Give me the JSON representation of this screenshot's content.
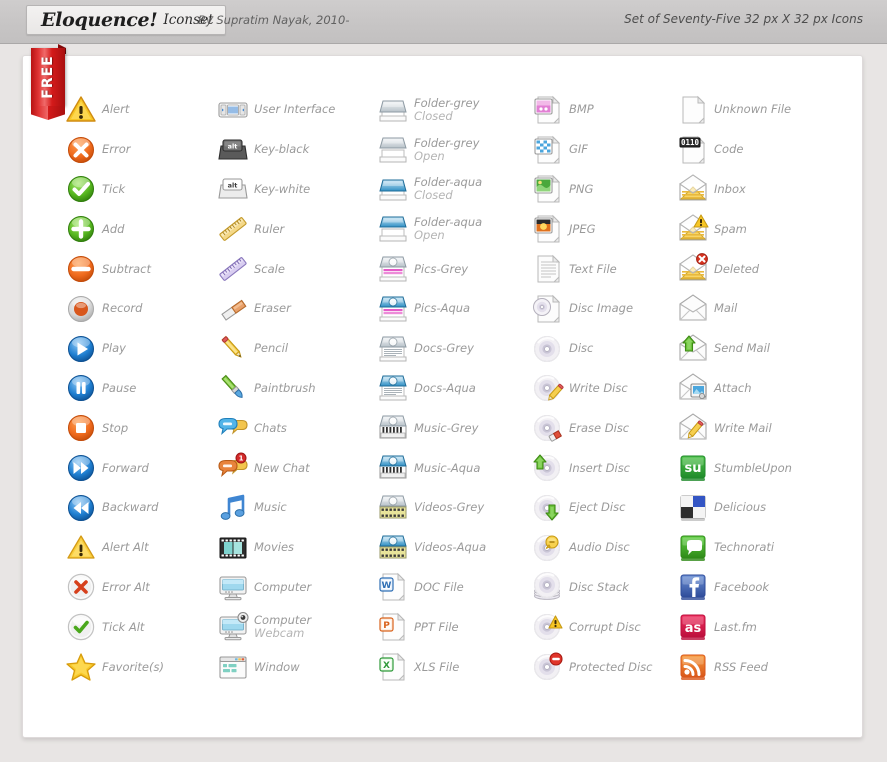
{
  "header": {
    "title_main": "Eloquence!",
    "title_sub": "Iconset",
    "byline": "By Supratim Nayak, 2010-",
    "right_text": "Set of Seventy-Five 32 px X 32 px Icons",
    "ribbon_label": "FREE"
  },
  "colors": {
    "page_bg": "#e8e5e4",
    "header_bg": "#c7c5c5",
    "card_bg": "#ffffff",
    "label_text": "#9a9a9a",
    "ribbon": "#d41a1a"
  },
  "columns": [
    {
      "name": "column-1",
      "items": [
        {
          "label": "Alert",
          "icon": "alert-icon"
        },
        {
          "label": "Error",
          "icon": "error-icon"
        },
        {
          "label": "Tick",
          "icon": "tick-icon"
        },
        {
          "label": "Add",
          "icon": "add-icon"
        },
        {
          "label": "Subtract",
          "icon": "subtract-icon"
        },
        {
          "label": "Record",
          "icon": "record-icon"
        },
        {
          "label": "Play",
          "icon": "play-icon"
        },
        {
          "label": "Pause",
          "icon": "pause-icon"
        },
        {
          "label": "Stop",
          "icon": "stop-icon"
        },
        {
          "label": "Forward",
          "icon": "forward-icon"
        },
        {
          "label": "Backward",
          "icon": "backward-icon"
        },
        {
          "label": "Alert Alt",
          "icon": "alert-alt-icon"
        },
        {
          "label": "Error Alt",
          "icon": "error-alt-icon"
        },
        {
          "label": "Tick Alt",
          "icon": "tick-alt-icon"
        },
        {
          "label": "Favorite(s)",
          "icon": "favorite-star-icon"
        }
      ]
    },
    {
      "name": "column-2",
      "items": [
        {
          "label": "User Interface",
          "icon": "user-interface-icon"
        },
        {
          "label": "Key-black",
          "icon": "key-black-icon"
        },
        {
          "label": "Key-white",
          "icon": "key-white-icon"
        },
        {
          "label": "Ruler",
          "icon": "ruler-icon"
        },
        {
          "label": "Scale",
          "icon": "scale-icon"
        },
        {
          "label": "Eraser",
          "icon": "eraser-icon"
        },
        {
          "label": "Pencil",
          "icon": "pencil-icon"
        },
        {
          "label": "Paintbrush",
          "icon": "paintbrush-icon"
        },
        {
          "label": "Chats",
          "icon": "chats-icon"
        },
        {
          "label": "New Chat",
          "icon": "new-chat-icon"
        },
        {
          "label": "Music",
          "icon": "music-note-icon"
        },
        {
          "label": "Movies",
          "icon": "movies-film-icon"
        },
        {
          "label": "Computer",
          "icon": "computer-icon"
        },
        {
          "label": "Computer",
          "label2": "Webcam",
          "icon": "computer-webcam-icon"
        },
        {
          "label": "Window",
          "icon": "window-icon"
        }
      ]
    },
    {
      "name": "column-3",
      "items": [
        {
          "label": "Folder-grey",
          "label2": "Closed",
          "icon": "folder-grey-closed-icon"
        },
        {
          "label": "Folder-grey",
          "label2": "Open",
          "icon": "folder-grey-open-icon"
        },
        {
          "label": "Folder-aqua",
          "label2": "Closed",
          "icon": "folder-aqua-closed-icon"
        },
        {
          "label": "Folder-aqua",
          "label2": "Open",
          "icon": "folder-aqua-open-icon"
        },
        {
          "label": "Pics-Grey",
          "icon": "pics-grey-icon"
        },
        {
          "label": "Pics-Aqua",
          "icon": "pics-aqua-icon"
        },
        {
          "label": "Docs-Grey",
          "icon": "docs-grey-icon"
        },
        {
          "label": "Docs-Aqua",
          "icon": "docs-aqua-icon"
        },
        {
          "label": "Music-Grey",
          "icon": "music-grey-icon"
        },
        {
          "label": "Music-Aqua",
          "icon": "music-aqua-icon"
        },
        {
          "label": "Videos-Grey",
          "icon": "videos-grey-icon"
        },
        {
          "label": "Videos-Aqua",
          "icon": "videos-aqua-icon"
        },
        {
          "label": "DOC File",
          "icon": "doc-file-icon"
        },
        {
          "label": "PPT File",
          "icon": "ppt-file-icon"
        },
        {
          "label": "XLS File",
          "icon": "xls-file-icon"
        }
      ]
    },
    {
      "name": "column-4",
      "items": [
        {
          "label": "BMP",
          "icon": "bmp-file-icon"
        },
        {
          "label": "GIF",
          "icon": "gif-file-icon"
        },
        {
          "label": "PNG",
          "icon": "png-file-icon"
        },
        {
          "label": "JPEG",
          "icon": "jpeg-file-icon"
        },
        {
          "label": "Text File",
          "icon": "text-file-icon"
        },
        {
          "label": "Disc Image",
          "icon": "disc-image-icon"
        },
        {
          "label": "Disc",
          "icon": "disc-icon"
        },
        {
          "label": "Write Disc",
          "icon": "write-disc-icon"
        },
        {
          "label": "Erase Disc",
          "icon": "erase-disc-icon"
        },
        {
          "label": "Insert Disc",
          "icon": "insert-disc-icon"
        },
        {
          "label": "Eject Disc",
          "icon": "eject-disc-icon"
        },
        {
          "label": "Audio Disc",
          "icon": "audio-disc-icon"
        },
        {
          "label": "Disc Stack",
          "icon": "disc-stack-icon"
        },
        {
          "label": "Corrupt Disc",
          "icon": "corrupt-disc-icon"
        },
        {
          "label": "Protected Disc",
          "icon": "protected-disc-icon"
        }
      ]
    },
    {
      "name": "column-5",
      "items": [
        {
          "label": "Unknown File",
          "icon": "unknown-file-icon"
        },
        {
          "label": "Code",
          "icon": "code-file-icon"
        },
        {
          "label": "Inbox",
          "icon": "inbox-icon"
        },
        {
          "label": "Spam",
          "icon": "spam-icon"
        },
        {
          "label": "Deleted",
          "icon": "deleted-mail-icon"
        },
        {
          "label": "Mail",
          "icon": "mail-icon"
        },
        {
          "label": "Send Mail",
          "icon": "send-mail-icon"
        },
        {
          "label": "Attach",
          "icon": "attach-icon"
        },
        {
          "label": "Write Mail",
          "icon": "write-mail-icon"
        },
        {
          "label": "StumbleUpon",
          "icon": "stumbleupon-icon"
        },
        {
          "label": "Delicious",
          "icon": "delicious-icon"
        },
        {
          "label": "Technorati",
          "icon": "technorati-icon"
        },
        {
          "label": "Facebook",
          "icon": "facebook-icon"
        },
        {
          "label": "Last.fm",
          "icon": "lastfm-icon"
        },
        {
          "label": "RSS Feed",
          "icon": "rss-feed-icon"
        }
      ]
    }
  ]
}
